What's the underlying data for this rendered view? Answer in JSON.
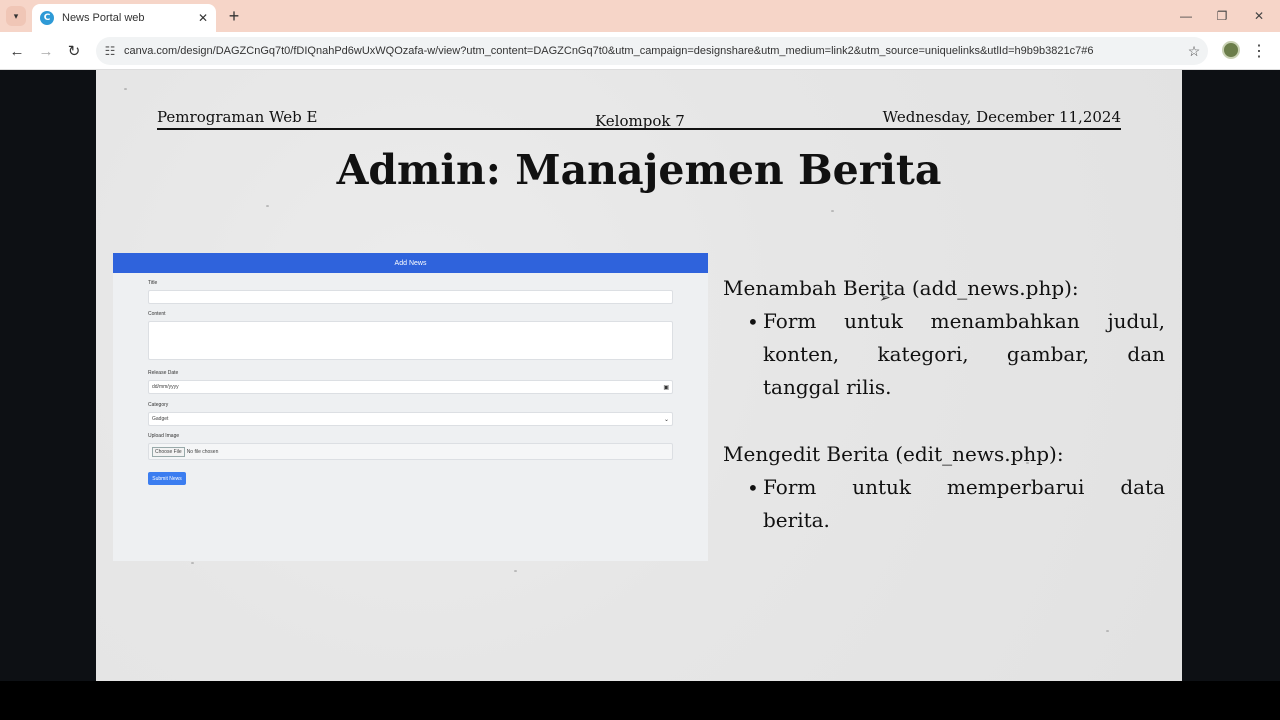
{
  "browser": {
    "tab_title": "News Portal web",
    "url": "canva.com/design/DAGZCnGq7t0/fDIQnahPd6wUxWQOzafa-w/view?utm_content=DAGZCnGq7t0&utm_campaign=designshare&utm_medium=link2&utm_source=uniquelinks&utlId=h9b9b3821c7#6",
    "favicon_letter": "C"
  },
  "slide": {
    "header_left": "Pemrograman Web E",
    "header_center": "Kelompok 7",
    "header_right": "Wednesday, December 11,2024",
    "title": "Admin: Manajemen Berita",
    "form": {
      "header": "Add News",
      "title_label": "Title",
      "content_label": "Content",
      "release_label": "Release Date",
      "release_placeholder": "dd/mm/yyyy",
      "category_label": "Category",
      "category_value": "Gadget",
      "upload_label": "Upload Image",
      "choose_file": "Choose File",
      "no_file": "No file chosen",
      "submit": "Submit News"
    },
    "section1_heading": "Menambah Berita (add_news.php):",
    "section1_lines": [
      "Form untuk menambahkan judul,",
      "konten, kategori, gambar, dan",
      "tanggal rilis."
    ],
    "section2_heading": "Mengedit Berita (edit_news.php):",
    "section2_lines": [
      "Form untuk memperbarui data",
      "berita."
    ]
  },
  "icons": {
    "tab_dropdown": "chevron-down-icon",
    "close": "close-icon",
    "new_tab": "plus-icon",
    "back": "back-arrow-icon",
    "forward": "forward-arrow-icon",
    "reload": "reload-icon",
    "site_settings": "tune-icon",
    "bookmark": "star-icon",
    "menu": "kebab-menu-icon"
  }
}
